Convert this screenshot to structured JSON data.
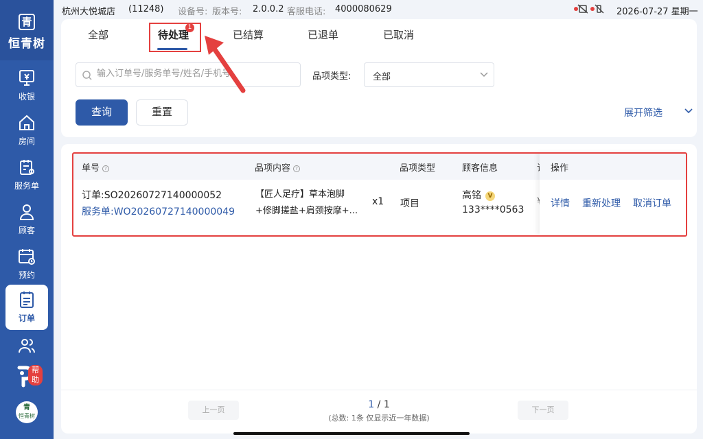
{
  "app": {
    "brand_mark": "青",
    "brand_name": "恒青树",
    "avatar_text": "恒青树"
  },
  "statusbar": {
    "store": "杭州大悦城店",
    "store_code": "(11248)",
    "device_label": "设备号:",
    "version_label": "版本号:",
    "version": "2.0.0.2",
    "service_tel_label": "客服电话:",
    "service_tel": "4000080629",
    "datetime": "2026-07-27 星期一"
  },
  "sidebar": {
    "items": [
      {
        "label": "收银",
        "icon": "cashier-icon"
      },
      {
        "label": "房间",
        "icon": "home-icon"
      },
      {
        "label": "服务单",
        "icon": "service-order-icon"
      },
      {
        "label": "顾客",
        "icon": "customer-icon"
      },
      {
        "label": "预约",
        "icon": "calendar-icon"
      },
      {
        "label": "订单",
        "icon": "order-icon",
        "active": true
      },
      {
        "label": "",
        "icon": "staff-icon"
      }
    ],
    "help_badge": "帮助"
  },
  "tabs": [
    {
      "label": "全部"
    },
    {
      "label": "待处理",
      "active": true,
      "badge": "1"
    },
    {
      "label": "已结算"
    },
    {
      "label": "已退单"
    },
    {
      "label": "已取消"
    }
  ],
  "filters": {
    "search_placeholder": "输入订单号/服务单号/姓名/手机号",
    "category_label": "品项类型:",
    "category_value": "全部",
    "query_button": "查询",
    "reset_button": "重置",
    "expand_label": "展开筛选"
  },
  "table": {
    "headers": {
      "order_no": "单号",
      "content": "品项内容",
      "type": "品项类型",
      "customer": "顾客信息",
      "partial": "订",
      "actions": "操作"
    },
    "rows": [
      {
        "order_label": "订单:",
        "order_no": "SO20260727140000052",
        "service_label": "服务单:",
        "service_no": "WO20260727140000049",
        "content_line1": "【匠人足疗】草本泡脚",
        "content_line2": "+修脚搓盐+肩颈按摩+...",
        "qty": "x1",
        "type": "项目",
        "customer_name": "高铭",
        "vip": "V",
        "customer_phone": "133****0563",
        "partial": "¥",
        "actions": [
          "详情",
          "重新处理",
          "取消订单"
        ]
      }
    ]
  },
  "pagination": {
    "prev": "上一页",
    "next": "下一页",
    "current": "1",
    "separator": " / ",
    "total_pages": "1",
    "info": "(总数: 1条 仅显示近一年数据)"
  },
  "colors": {
    "primary": "#2e5aa8",
    "highlight": "#e4403f"
  }
}
